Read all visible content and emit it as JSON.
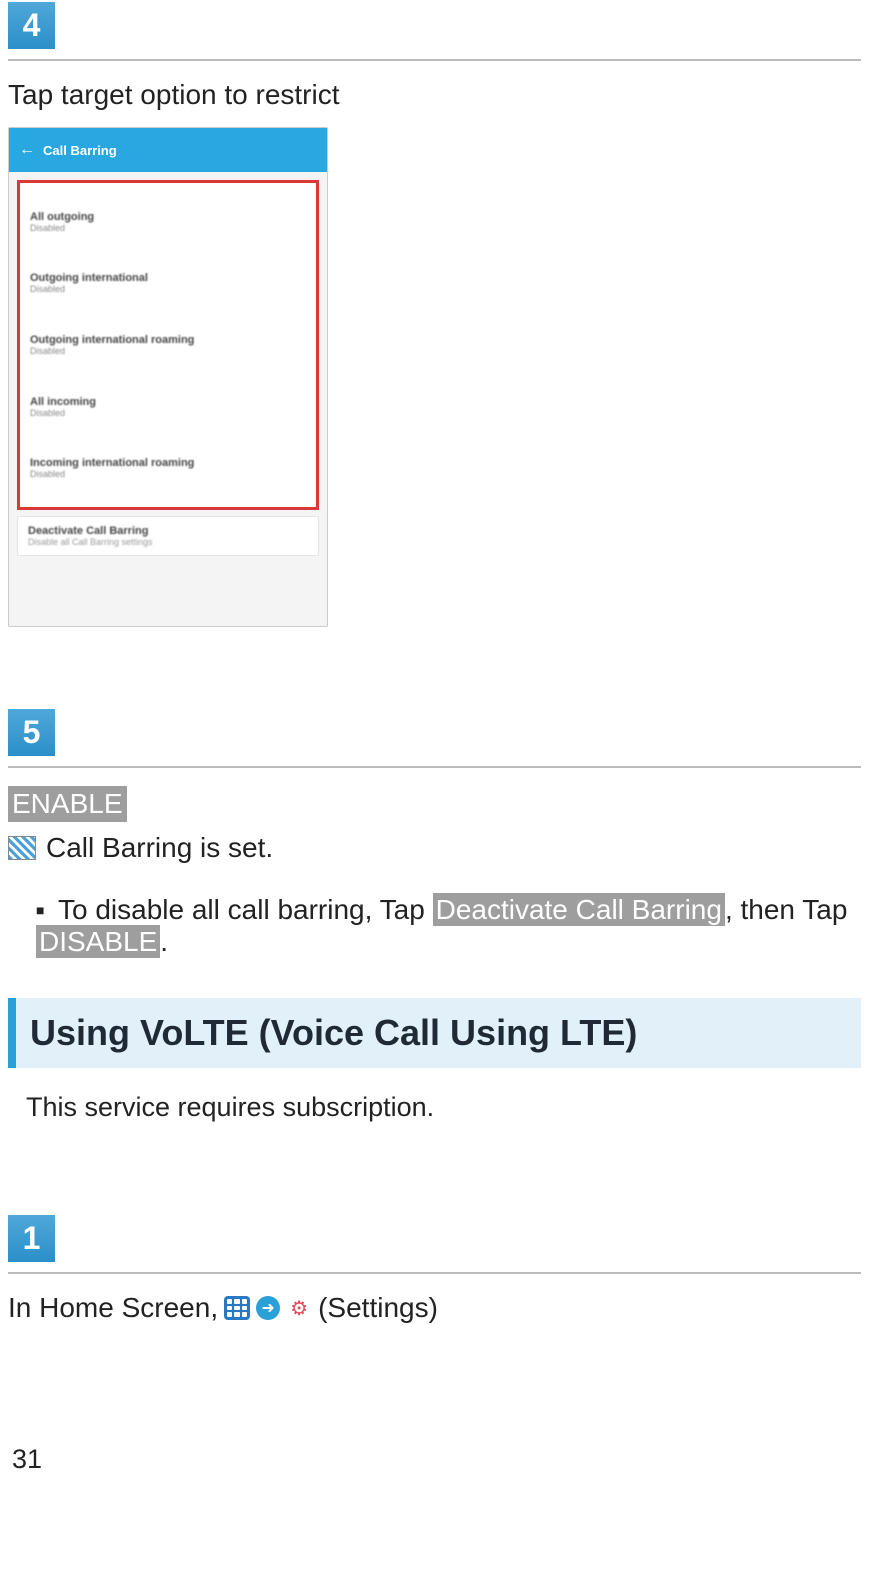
{
  "step4": {
    "number": "4",
    "instruction": "Tap target option to restrict",
    "screenshot": {
      "header": "Call Barring",
      "items": [
        {
          "title": "All outgoing",
          "sub": "Disabled"
        },
        {
          "title": "Outgoing international",
          "sub": "Disabled"
        },
        {
          "title": "Outgoing international roaming",
          "sub": "Disabled"
        },
        {
          "title": "All incoming",
          "sub": "Disabled"
        },
        {
          "title": "Incoming international roaming",
          "sub": "Disabled"
        }
      ],
      "footer": {
        "title": "Deactivate Call Barring",
        "sub": "Disable all Call Barring settings"
      }
    }
  },
  "step5": {
    "number": "5",
    "enable_label": "ENABLE",
    "result_text": "Call Barring is set.",
    "bullet_prefix": "To disable all call barring, Tap ",
    "bullet_btn1": "Deactivate Call Barring",
    "bullet_mid": ", then Tap ",
    "bullet_btn2": "DISABLE",
    "bullet_suffix": "."
  },
  "section": {
    "heading": "Using VoLTE (Voice Call Using LTE)",
    "note": "This service requires subscription."
  },
  "step1": {
    "number": "1",
    "prefix": "In Home Screen, ",
    "suffix": " (Settings)"
  },
  "page_number": "31"
}
